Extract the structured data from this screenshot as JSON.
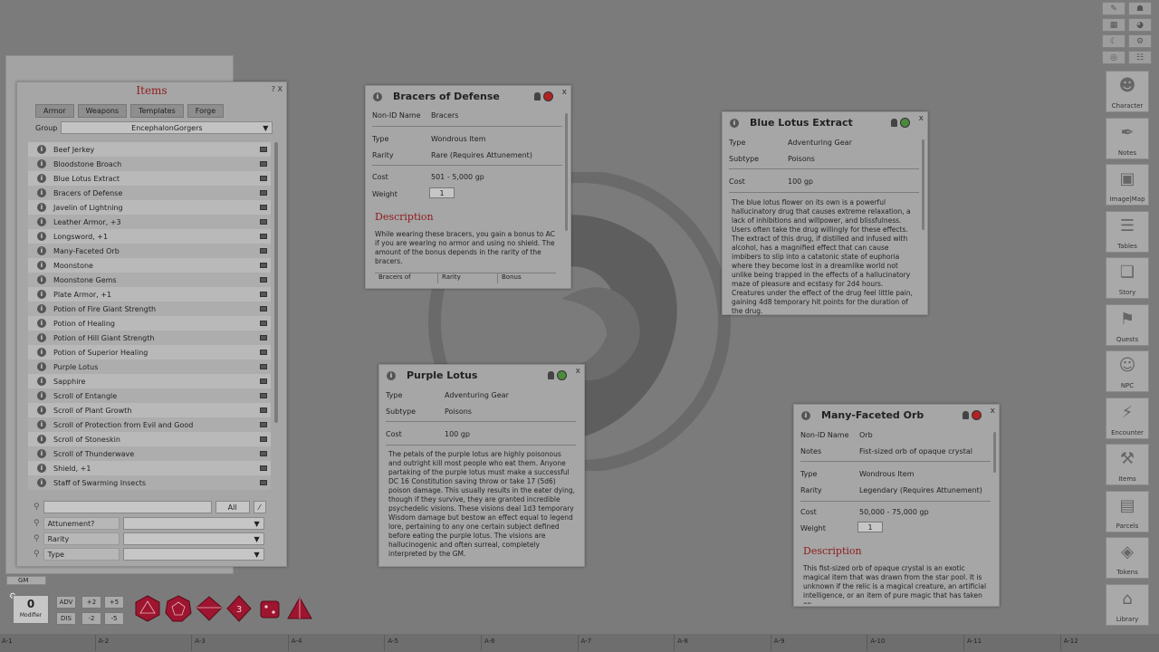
{
  "items_panel": {
    "title": "Items",
    "help_icons": "? X",
    "tabs": [
      "Armor",
      "Weapons",
      "Templates",
      "Forge"
    ],
    "group_label": "Group",
    "group_value": "EncephalonGorgers",
    "items": [
      "Beef Jerkey",
      "Bloodstone Broach",
      "Blue Lotus Extract",
      "Bracers of Defense",
      "Javelin of Lightning",
      "Leather Armor, +3",
      "Longsword, +1",
      "Many-Faceted Orb",
      "Moonstone",
      "Moonstone Gems",
      "Plate Armor, +1",
      "Potion of Fire Giant Strength",
      "Potion of Healing",
      "Potion of Hill Giant Strength",
      "Potion of Superior Healing",
      "Purple Lotus",
      "Sapphire",
      "Scroll of Entangle",
      "Scroll of Plant Growth",
      "Scroll of Protection from Evil and Good",
      "Scroll of Stoneskin",
      "Scroll of Thunderwave",
      "Shield, +1",
      "Staff of Swarming Insects"
    ],
    "search_all": "All",
    "filters": [
      "Attunement?",
      "Rarity",
      "Type"
    ]
  },
  "bracers": {
    "title": "Bracers of Defense",
    "nonid_label": "Non-ID Name",
    "nonid_value": "Bracers",
    "type_label": "Type",
    "type_value": "Wondrous Item",
    "rarity_label": "Rarity",
    "rarity_value": "Rare (Requires Attunement)",
    "cost_label": "Cost",
    "cost_value": "501 - 5,000 gp",
    "weight_label": "Weight",
    "weight_value": "1",
    "desc_heading": "Description",
    "desc": "While wearing these bracers, you gain a bonus to AC if you are wearing no armor and using no shield. The amount of the bonus depends in the rarity of the bracers.",
    "table_cols": [
      "Bracers of",
      "Rarity",
      "Bonus"
    ]
  },
  "blue_lotus": {
    "title": "Blue Lotus Extract",
    "type_label": "Type",
    "type_value": "Adventuring Gear",
    "subtype_label": "Subtype",
    "subtype_value": "Poisons",
    "cost_label": "Cost",
    "cost_value": "100 gp",
    "desc": "The blue lotus flower on its own is a powerful hallucinatory drug that causes extreme relaxation, a lack of inhibitions and willpower, and blissfulness. Users often take the drug willingly for these effects. The extract of this drug, if distilled and infused with alcohol, has a magnified effect that can cause imbibers to slip into a catatonic state of euphoria where they become lost in a dreamlike world not unlike being trapped in the effects of a hallucinatory maze of pleasure and ecstasy for 2d4 hours. Creatures under the effect of the drug feel little pain, gaining 4d8 temporary hit points for the duration of the drug."
  },
  "purple_lotus": {
    "title": "Purple Lotus",
    "type_label": "Type",
    "type_value": "Adventuring Gear",
    "subtype_label": "Subtype",
    "subtype_value": "Poisons",
    "cost_label": "Cost",
    "cost_value": "100 gp",
    "desc": "The petals of the purple lotus are highly poisonous and outright kill most people who eat them. Anyone partaking of the purple lotus must make a successful DC 16 Constitution saving throw or take 17 (5d6) poison damage. This usually results in the eater dying, though if they survive, they are granted incredible psychedelic visions. These visions deal 1d3 temporary Wisdom damage but bestow an effect equal to legend lore, pertaining to any one certain subject defined before eating the purple lotus. The visions are hallucinogenic and often surreal, completely interpreted by the GM."
  },
  "orb": {
    "title": "Many-Faceted Orb",
    "nonid_label": "Non-ID Name",
    "nonid_value": "Orb",
    "notes_label": "Notes",
    "notes_value": "Fist-sized orb of opaque crystal",
    "type_label": "Type",
    "type_value": "Wondrous Item",
    "rarity_label": "Rarity",
    "rarity_value": "Legendary (Requires Attunement)",
    "cost_label": "Cost",
    "cost_value": "50,000 - 75,000 gp",
    "weight_label": "Weight",
    "weight_value": "1",
    "desc_heading": "Description",
    "desc": "This fist-sized orb of opaque crystal is an exotic magical item that was drawn from the star pool. It is unknown if the relic is a magical creature, an artificial intelligence, or an item of pure magic that has taken on"
  },
  "sidebar": [
    {
      "label": "Character",
      "icon": "person-icon"
    },
    {
      "label": "Notes",
      "icon": "quill-icon"
    },
    {
      "label": "Image|Map",
      "icon": "image-icon"
    },
    {
      "label": "Tables",
      "icon": "list-icon"
    },
    {
      "label": "Story",
      "icon": "book-icon"
    },
    {
      "label": "Quests",
      "icon": "flag-icon"
    },
    {
      "label": "NPC",
      "icon": "npc-icon"
    },
    {
      "label": "Encounter",
      "icon": "lightning-icon"
    },
    {
      "label": "Items",
      "icon": "anvil-icon"
    },
    {
      "label": "Parcels",
      "icon": "chest-icon"
    },
    {
      "label": "Tokens",
      "icon": "layers-icon"
    },
    {
      "label": "Library",
      "icon": "library-icon"
    }
  ],
  "bottom": {
    "gm": "GM",
    "modifier_value": "0",
    "modifier_label": "Modifier",
    "adv": "ADV",
    "dis": "DIS",
    "plus2": "+2",
    "plus5": "+5",
    "minus2": "-2",
    "minus5": "-5",
    "grid_labels": [
      "A-1",
      "A-2",
      "A-3",
      "A-4",
      "A-5",
      "A-6",
      "A-7",
      "A-8",
      "A-9",
      "A-10",
      "A-11",
      "A-12"
    ],
    "dice": [
      "d20",
      "d12",
      "d10",
      "d8",
      "d6",
      "d4"
    ]
  },
  "colors": {
    "accent_red": "#8e1b1b",
    "dice_red": "#9e1530",
    "background": "#7b7b7b"
  }
}
